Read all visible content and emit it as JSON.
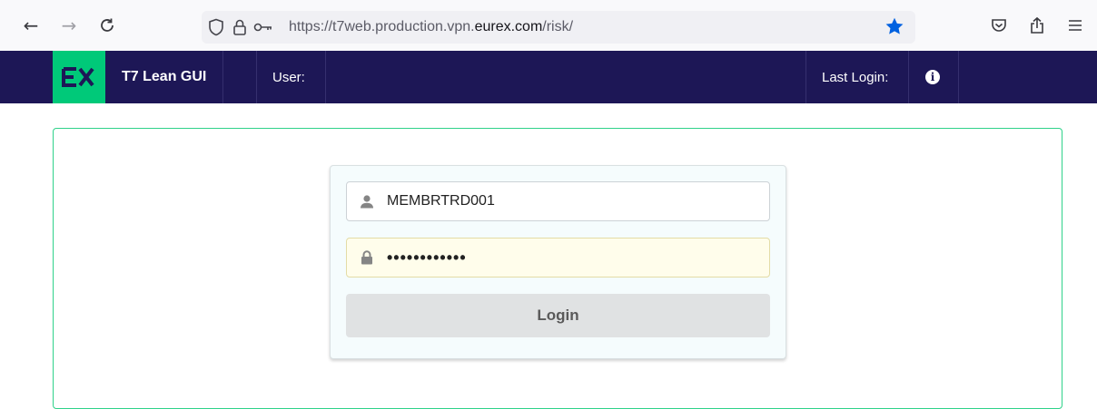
{
  "browser": {
    "url_prefix": "https://t7web.production.vpn.",
    "url_domain": "eurex.com",
    "url_suffix": "/risk/",
    "icons": [
      "back-arrow-icon",
      "forward-arrow-icon",
      "reload-icon",
      "shield-icon",
      "lock-icon",
      "key-icon",
      "bookmark-star-icon",
      "pocket-icon",
      "share-icon",
      "menu-icon"
    ],
    "star_color": "#0061e0"
  },
  "header": {
    "logo_text": "EX",
    "app_title": "T7 Lean GUI",
    "user_label": "User:",
    "last_login_label": "Last Login:",
    "background_color": "#1d1756",
    "logo_color": "#00c979"
  },
  "login": {
    "username_value": "MEMBRTRD001",
    "password_value": "••••••••••••",
    "login_button_label": "Login"
  }
}
